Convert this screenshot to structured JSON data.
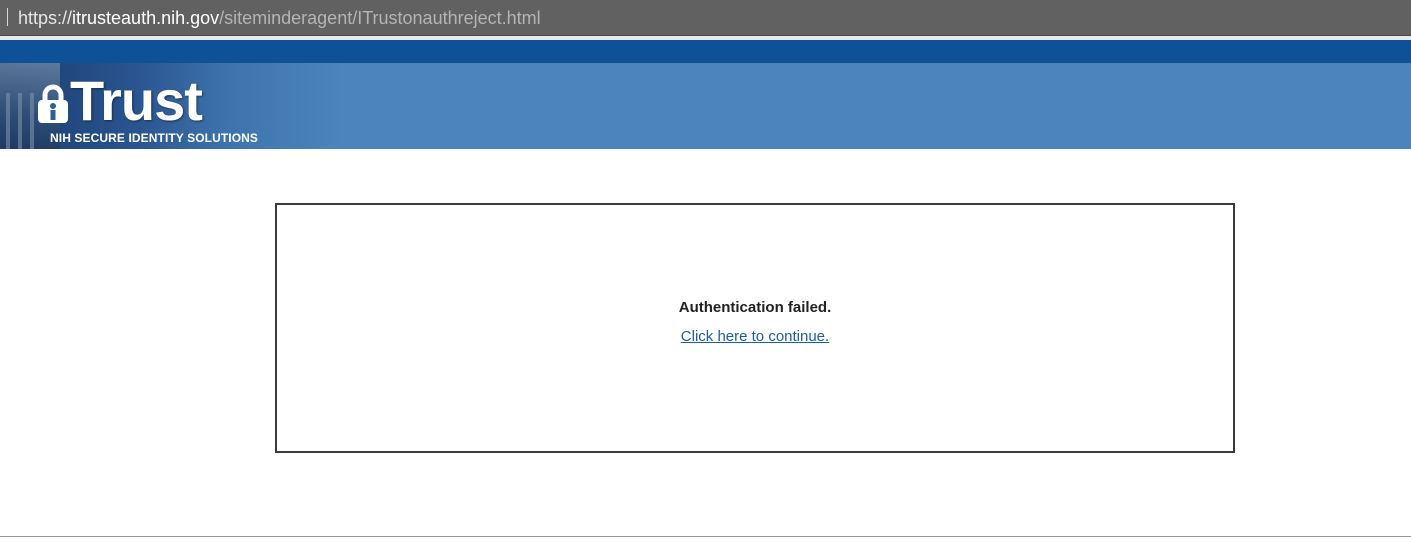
{
  "address_bar": {
    "scheme": "https://",
    "host": "itrusteauth.nih.gov",
    "path": "/siteminderagent/ITrustonauthreject.html"
  },
  "banner": {
    "brand": "Trust",
    "brand_icon": "padlock-i-icon",
    "tagline": "NIH SECURE IDENTITY SOLUTIONS"
  },
  "message": {
    "title": "Authentication failed.",
    "link_text": "Click here to continue."
  },
  "colors": {
    "banner_dark": "#0f5196",
    "banner": "#4c85bd",
    "link": "#1a5ea8"
  }
}
